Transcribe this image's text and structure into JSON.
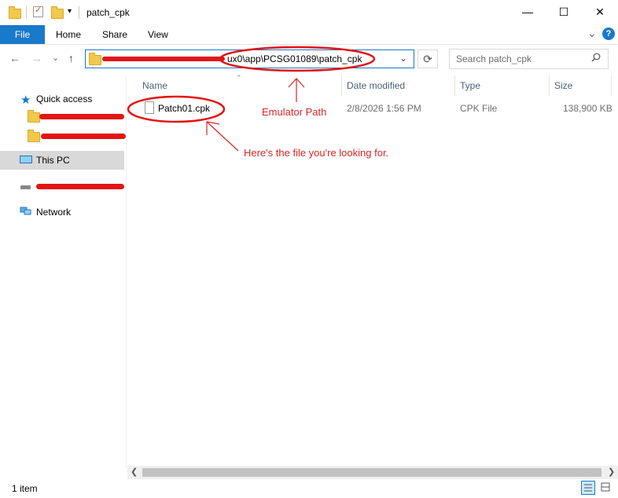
{
  "window": {
    "title": "patch_cpk",
    "minimize": "—",
    "maximize": "☐",
    "close": "✕"
  },
  "ribbon": {
    "tabs": [
      "File",
      "Home",
      "Share",
      "View"
    ],
    "expand": "⌄",
    "help": "?"
  },
  "nav": {
    "back": "←",
    "forward": "→",
    "recent": "⌄",
    "up": "↑",
    "address_visible": "ux0\\app\\PCSG01089\\patch_cpk",
    "address_dropdown": "⌄",
    "refresh": "⟳",
    "search_placeholder": "Search patch_cpk",
    "search_icon": "magnifier"
  },
  "sidebar": {
    "items": [
      {
        "label": "Quick access",
        "icon": "star-icon"
      },
      {
        "label": "",
        "icon": "folder-icon"
      },
      {
        "label": "",
        "icon": "folder-icon"
      },
      {
        "label": "This PC",
        "icon": "computer-icon",
        "selected": true
      },
      {
        "label": "",
        "icon": "drive-icon"
      },
      {
        "label": "Network",
        "icon": "network-icon"
      }
    ]
  },
  "columns": [
    "Name",
    "Date modified",
    "Type",
    "Size"
  ],
  "files": [
    {
      "name": "Patch01.cpk",
      "date": "2/8/2026 1:56 PM",
      "type": "CPK File",
      "size": "138,900 KB"
    }
  ],
  "status": {
    "count": "1 item"
  },
  "annotations": {
    "path_label": "Emulator Path",
    "file_label": "Here's the file you're looking for.",
    "color": "#d92626"
  },
  "colors": {
    "accent": "#1979ca",
    "selection": "#d9d9d9"
  }
}
